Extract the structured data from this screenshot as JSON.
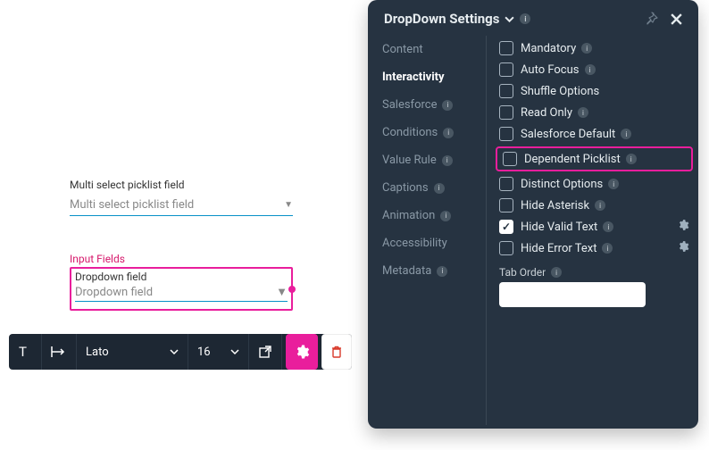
{
  "panel": {
    "title": "DropDown Settings"
  },
  "side_tabs": {
    "content": "Content",
    "interactivity": "Interactivity",
    "salesforce": "Salesforce",
    "conditions": "Conditions",
    "value_rule": "Value Rule",
    "captions": "Captions",
    "animation": "Animation",
    "accessibility": "Accessibility",
    "metadata": "Metadata"
  },
  "settings": {
    "mandatory": "Mandatory",
    "auto_focus": "Auto Focus",
    "shuffle_options": "Shuffle Options",
    "read_only": "Read Only",
    "salesforce_default": "Salesforce Default",
    "dependent_picklist": "Dependent Picklist",
    "distinct_options": "Distinct Options",
    "hide_asterisk": "Hide Asterisk",
    "hide_valid_text": "Hide Valid Text",
    "hide_error_text": "Hide Error Text",
    "tab_order": "Tab Order"
  },
  "canvas": {
    "multi_label": "Multi select picklist field",
    "multi_placeholder": "Multi select picklist field",
    "input_fields_title": "Input Fields",
    "dropdown_label": "Dropdown field",
    "dropdown_placeholder": "Dropdown field"
  },
  "toolbar": {
    "font": "Lato",
    "size": "16"
  }
}
